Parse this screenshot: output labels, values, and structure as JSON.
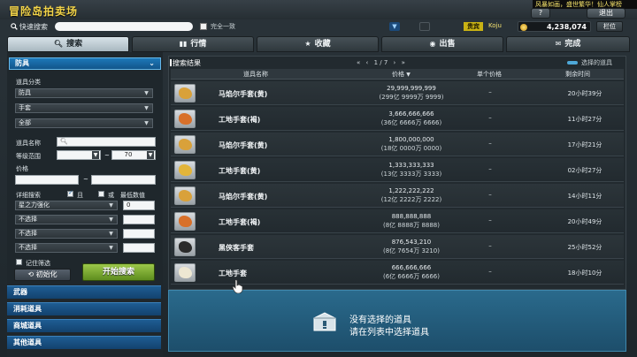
{
  "header": {
    "title": "冒险岛拍卖场",
    "ticker": "风暴如画，盛世繁华！仙人掌榜",
    "help_label": "?",
    "exit_label": "退出",
    "search_label": "快速搜索",
    "search_value": "",
    "exact_label": "完全一致",
    "vip_label": "贵宾",
    "vip_name": "Koju",
    "coin_value": "4,238,074",
    "slot_label": "栏位"
  },
  "tabs": [
    {
      "label": "搜索",
      "icon": "search-icon",
      "active": true
    },
    {
      "label": "行情",
      "icon": "chart-icon",
      "active": false
    },
    {
      "label": "收藏",
      "icon": "star-icon",
      "active": false
    },
    {
      "label": "出售",
      "icon": "coin-icon",
      "active": false
    },
    {
      "label": "完成",
      "icon": "mail-icon",
      "active": false
    }
  ],
  "left": {
    "category_header": "防具",
    "item_class_label": "道具分类",
    "class_1": "防具",
    "class_2": "手套",
    "class_3": "全部",
    "item_name_label": "道具名称",
    "level_label": "等级范围",
    "level_min": "",
    "level_max": "70",
    "level_sep": "~",
    "price_label": "价格",
    "price_sep": "~",
    "detail_label": "详细搜索",
    "and_label": "且",
    "or_label": "或",
    "min_value_label": "最低数值",
    "options": [
      {
        "label": "星之力强化",
        "value": "0"
      },
      {
        "label": "不选择",
        "value": ""
      },
      {
        "label": "不选择",
        "value": ""
      },
      {
        "label": "不选择",
        "value": ""
      }
    ],
    "remember_label": "记住筛选",
    "init_label": "初始化",
    "start_label": "开始搜索",
    "categories": [
      "武器",
      "消耗道具",
      "商城道具",
      "其他道具"
    ]
  },
  "results": {
    "title": "搜索结果",
    "pager_first": "«",
    "pager_prev": "‹",
    "pager_text": "1 / 7",
    "pager_next": "›",
    "pager_last": "»",
    "selected_label": "选择的道具",
    "columns": [
      "道具名称",
      "价格",
      "单个价格",
      "剩余时间"
    ],
    "price_sort": "▼",
    "rows": [
      {
        "name": "马焰尔手套(黄)",
        "price": "29,999,999,999",
        "price_detail": "(299亿 9999万 9999)",
        "unit": "–",
        "time": "20小时39分",
        "color": "#d9a13a"
      },
      {
        "name": "工地手套(褐)",
        "price": "3,666,666,666",
        "price_detail": "(36亿 6666万 6666)",
        "unit": "–",
        "time": "11小时27分",
        "color": "#d8702a"
      },
      {
        "name": "马焰尔手套(黄)",
        "price": "1,800,000,000",
        "price_detail": "(18亿 0000万 0000)",
        "unit": "–",
        "time": "17小时21分",
        "color": "#d9a13a"
      },
      {
        "name": "工地手套(黄)",
        "price": "1,333,333,333",
        "price_detail": "(13亿 3333万 3333)",
        "unit": "–",
        "time": "02小时27分",
        "color": "#e3b53a"
      },
      {
        "name": "马焰尔手套(黄)",
        "price": "1,222,222,222",
        "price_detail": "(12亿 2222万 2222)",
        "unit": "–",
        "time": "14小时11分",
        "color": "#d9a13a"
      },
      {
        "name": "工地手套(褐)",
        "price": "888,888,888",
        "price_detail": "(8亿 8888万 8888)",
        "unit": "–",
        "time": "20小时49分",
        "color": "#d8702a"
      },
      {
        "name": "黑侠客手套",
        "price": "876,543,210",
        "price_detail": "(8亿 7654万 3210)",
        "unit": "–",
        "time": "25小时52分",
        "color": "#2a2a2a"
      },
      {
        "name": "工地手套",
        "price": "666,666,666",
        "price_detail": "(6亿 6666万 6666)",
        "unit": "–",
        "time": "18小时10分",
        "color": "#ede7d2"
      }
    ]
  },
  "detail": {
    "empty_line1": "没有选择的道具",
    "empty_line2": "请在列表中选择道具"
  }
}
